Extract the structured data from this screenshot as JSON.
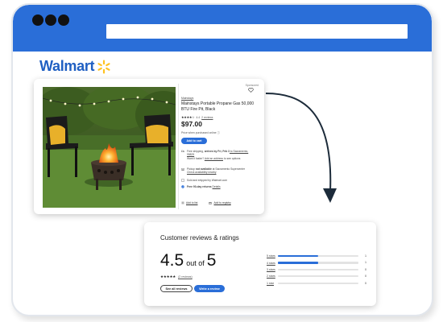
{
  "brand": {
    "name": "Walmart",
    "accent": "#2a6ed8",
    "spark_color": "#ffc220"
  },
  "product": {
    "sponsored": "Sponsored",
    "brand_link": "Mainstays",
    "title": "Mainstays Portable Propane Gas 50,000 BTU Fire Pit, Black",
    "stars": "★★★★☆",
    "rating_count": "4.4",
    "reviews_link": "2 reviews",
    "price": "$97.00",
    "price_note": "Price when purchased online ⓘ",
    "add_to_cart": "Add to cart",
    "shipping_pre": "Free shipping, ",
    "shipping_bold": "arrives by Fri, Feb 3",
    "shipping_to": " to Sacramento, 95829",
    "shipping_sub_pre": "Want it faster? ",
    "shipping_sub_link": "Add an address",
    "shipping_sub_post": " to see options",
    "pickup_pre": "Pickup ",
    "pickup_bold": "not available",
    "pickup_post": " at Sacramento Supercenter",
    "pickup_link": "Check availability nearby",
    "sold_by": "Sold and shipped by Walmart.com",
    "returns_bold": "Free 90-day returns",
    "returns_link": "Details",
    "add_to_list": "Add to list",
    "add_to_registry": "Add to registry"
  },
  "reviews": {
    "title": "Customer reviews & ratings",
    "average": "4.5",
    "out_of": "out of",
    "max": "5",
    "stars": "★★★★★",
    "count_link": "(2 reviews)",
    "see_all": "See all reviews",
    "write": "Write a review",
    "distribution": [
      {
        "label": "5 stars",
        "count": "1",
        "fraction": 0.5
      },
      {
        "label": "4 stars",
        "count": "1",
        "fraction": 0.5
      },
      {
        "label": "3 stars",
        "count": "0",
        "fraction": 0
      },
      {
        "label": "2 stars",
        "count": "0",
        "fraction": 0
      },
      {
        "label": "1 star",
        "count": "0",
        "fraction": 0
      }
    ]
  }
}
